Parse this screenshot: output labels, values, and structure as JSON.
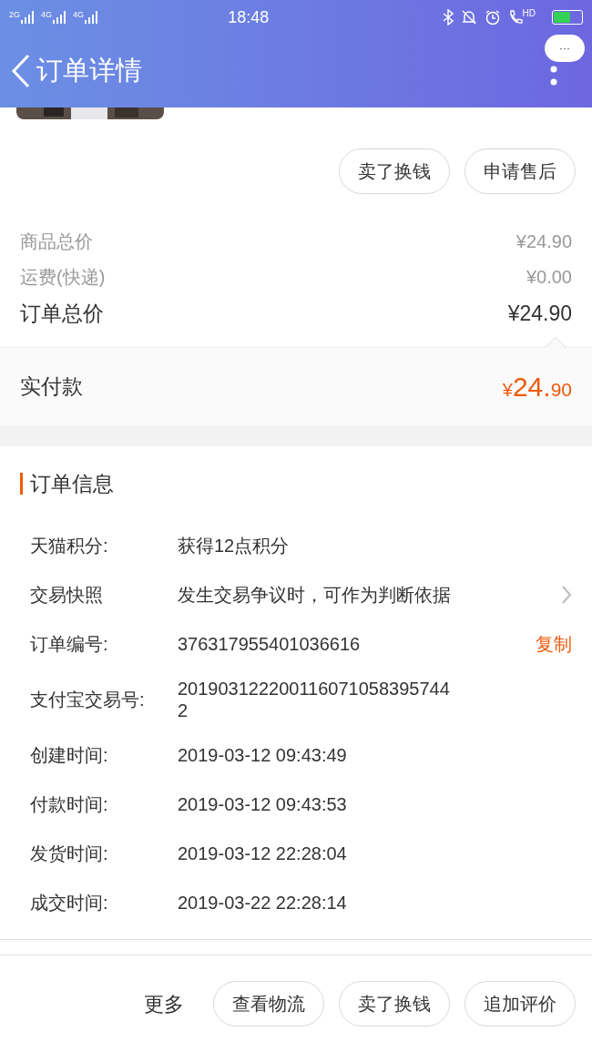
{
  "status_bar": {
    "signals": [
      "2G",
      "4G",
      "4G"
    ],
    "time": "18:48",
    "hd": "HD"
  },
  "header": {
    "title": "订单详情",
    "more_bubble": "···"
  },
  "product": {
    "kind": "picture"
  },
  "item_buttons": [
    "卖了换钱",
    "申请售后"
  ],
  "price_rows": [
    {
      "label": "商品总价",
      "value": "¥24.90",
      "emphasis": false
    },
    {
      "label": "运费(快递)",
      "value": "¥0.00",
      "emphasis": false
    },
    {
      "label": "订单总价",
      "value": "¥24.90",
      "emphasis": true
    }
  ],
  "paid": {
    "label": "实付款",
    "currency": "¥",
    "integer": "24.",
    "decimal": "90"
  },
  "order_info": {
    "title": "订单信息",
    "rows": [
      {
        "label": "天猫积分:",
        "value": "获得12点积分",
        "chevron": false
      },
      {
        "label": "交易快照",
        "value": "发生交易争议时，可作为判断依据",
        "chevron": true
      },
      {
        "label": "订单编号:",
        "value": "376317955401036616",
        "action": "复制",
        "chevron": false
      },
      {
        "label": "支付宝交易号:",
        "value": "2019031222001160710583957442",
        "chevron": false
      },
      {
        "label": "创建时间:",
        "value": "2019-03-12 09:43:49",
        "chevron": false
      },
      {
        "label": "付款时间:",
        "value": "2019-03-12 09:43:53",
        "chevron": false
      },
      {
        "label": "发货时间:",
        "value": "2019-03-12 22:28:04",
        "chevron": false
      },
      {
        "label": "成交时间:",
        "value": "2019-03-22 22:28:14",
        "chevron": false
      }
    ]
  },
  "bottom_bar": {
    "more": "更多",
    "buttons": [
      "查看物流",
      "卖了换钱",
      "追加评价"
    ]
  }
}
